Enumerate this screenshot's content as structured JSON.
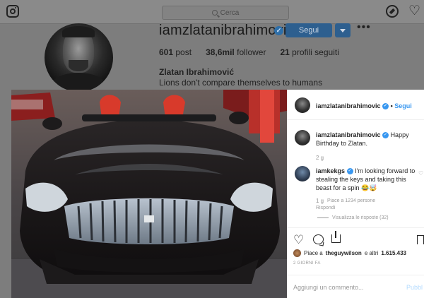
{
  "topbar": {
    "search_placeholder": "Cerca",
    "icons": [
      "instagram-icon",
      "search-icon",
      "explore-icon",
      "heart-icon"
    ]
  },
  "profile": {
    "username": "iamzlatanibrahimovic",
    "verified_mark": "✓",
    "follow_label": "Segui",
    "more_label": "•••",
    "stats": {
      "posts": "601",
      "posts_label": "post",
      "followers": "38,6mil",
      "followers_label": "follower",
      "following": "21",
      "following_label": "profili seguiti"
    },
    "full_name": "Zlatan Ibrahimović",
    "bio": "Lions don't compare themselves to humans"
  },
  "post": {
    "header": {
      "username": "iamzlatanibrahimovic",
      "separator": " • ",
      "follow_label": "Segui"
    },
    "comments": [
      {
        "username": "iamzlatanibrahimovic",
        "text": "Happy Birthday to Zlatan.",
        "time": "2 g"
      },
      {
        "username": "iamkekgs",
        "text": "I'm looking forward to stealing the keys and taking this beast for a spin 😂🤯",
        "time": "1 g",
        "likes_text": "Piace a 1234 persone",
        "reply_label": "Rispondi",
        "view_replies_label": "Visualizza le risposte (32)"
      }
    ],
    "likes": {
      "prefix": "Piace a",
      "user": "theguywilson",
      "suffix": "e altri",
      "count": "1.615.433"
    },
    "timestamp": "2 GIORNI FA",
    "add_comment_placeholder": "Aggiungi un commento...",
    "publish_label": "Pubbl"
  },
  "colors": {
    "follow_blue": "#3897f0",
    "dim_overlay": "#7d7d7d"
  }
}
